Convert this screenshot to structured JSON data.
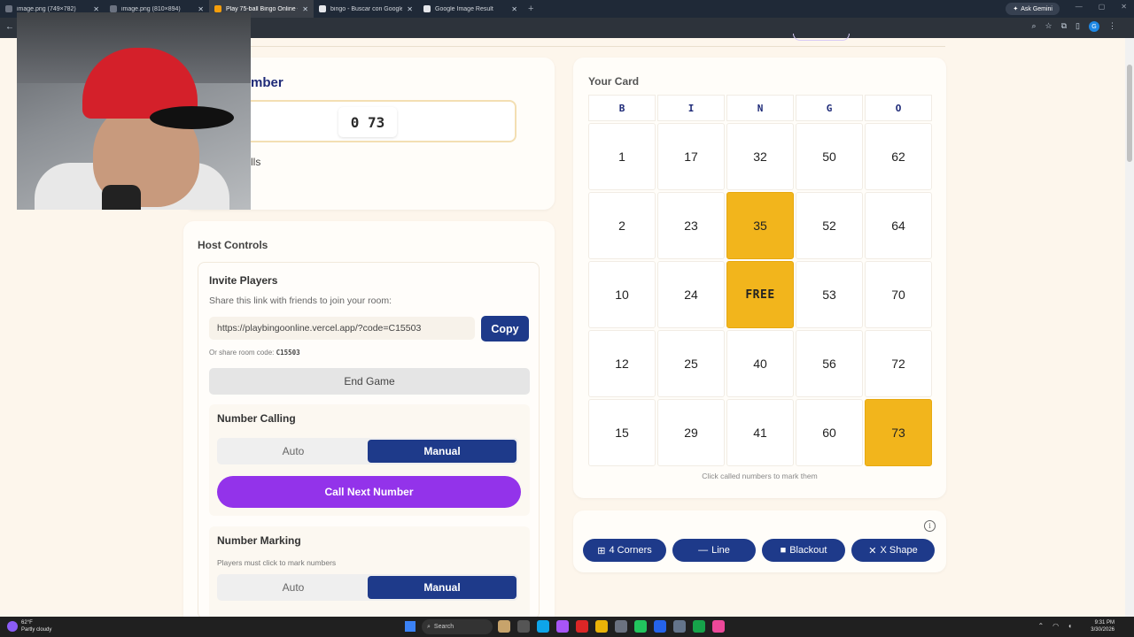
{
  "browser": {
    "tabs": [
      {
        "title": "image.png (749×782)",
        "color": "#6b7280"
      },
      {
        "title": "image.png (810×894)",
        "color": "#6b7280"
      },
      {
        "title": "Play 75-ball Bingo Online • Roo",
        "color": "#f59e0b",
        "active": true
      },
      {
        "title": "bingo - Buscar con Google",
        "color": "#e5e7eb"
      },
      {
        "title": "Google Image Result",
        "color": "#e5e7eb"
      }
    ],
    "gemini_label": "Ask Gemini",
    "profile_initial": "G"
  },
  "called": {
    "title_partial": "mber",
    "current_number": "0 73",
    "sub_partial": "lls"
  },
  "host": {
    "title": "Host Controls",
    "invite_title": "Invite Players",
    "invite_sub": "Share this link with friends to join your room:",
    "link": "https://playbingoonline.vercel.app/?code=C15503",
    "copy_label": "Copy",
    "room_code_label": "Or share room code:",
    "room_code": "C15503",
    "end_game_label": "End Game",
    "number_calling": {
      "title": "Number Calling",
      "options": [
        "Auto",
        "Manual"
      ],
      "selected": "Manual",
      "call_next_label": "Call Next Number"
    },
    "number_marking": {
      "title": "Number Marking",
      "note": "Players must click to mark numbers",
      "options": [
        "Auto",
        "Manual"
      ],
      "selected": "Manual"
    }
  },
  "card": {
    "label": "Your Card",
    "headers": [
      "B",
      "I",
      "N",
      "G",
      "O"
    ],
    "rows": [
      [
        {
          "v": "1"
        },
        {
          "v": "17"
        },
        {
          "v": "32"
        },
        {
          "v": "50"
        },
        {
          "v": "62"
        }
      ],
      [
        {
          "v": "2"
        },
        {
          "v": "23"
        },
        {
          "v": "35",
          "marked": true
        },
        {
          "v": "52"
        },
        {
          "v": "64"
        }
      ],
      [
        {
          "v": "10"
        },
        {
          "v": "24"
        },
        {
          "v": "FREE",
          "marked": true,
          "free": true
        },
        {
          "v": "53"
        },
        {
          "v": "70"
        }
      ],
      [
        {
          "v": "12"
        },
        {
          "v": "25"
        },
        {
          "v": "40"
        },
        {
          "v": "56"
        },
        {
          "v": "72"
        }
      ],
      [
        {
          "v": "15"
        },
        {
          "v": "29"
        },
        {
          "v": "41"
        },
        {
          "v": "60"
        },
        {
          "v": "73",
          "marked": true
        }
      ]
    ],
    "hint": "Click called numbers to mark them",
    "marked_color": "#f2b51c"
  },
  "patterns": {
    "items": [
      {
        "label": "4 Corners",
        "icon": "corners-icon",
        "glyph": "⊞"
      },
      {
        "label": "Line",
        "icon": "line-icon",
        "glyph": "—"
      },
      {
        "label": "Blackout",
        "icon": "square-icon",
        "glyph": "■"
      },
      {
        "label": "X Shape",
        "icon": "x-icon",
        "glyph": "✕"
      }
    ],
    "info_glyph": "i"
  },
  "taskbar": {
    "temp": "62°F",
    "weather": "Partly cloudy",
    "search_label": "Search",
    "time": "9:31 PM",
    "date": "3/30/2026"
  },
  "colors": {
    "accent": "#1e3a8a",
    "purple": "#9333ea",
    "background": "#fdf6ec"
  }
}
